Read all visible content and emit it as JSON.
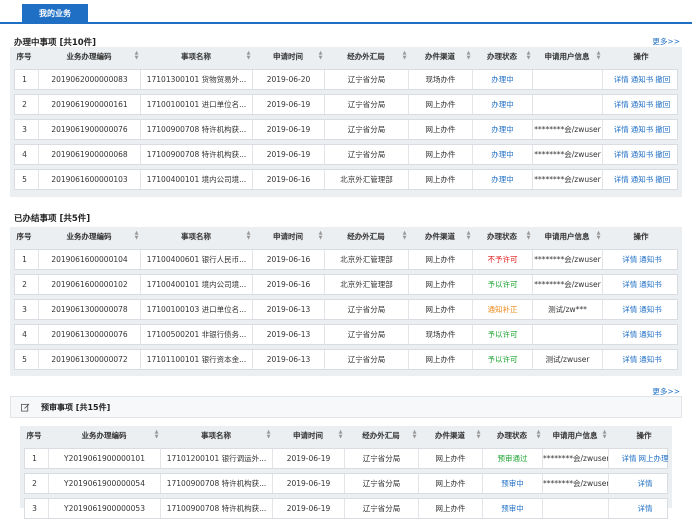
{
  "tab": {
    "label": "我的业务"
  },
  "sections": [
    {
      "title": "办理中事项 [共10件]",
      "more": "更多>>",
      "columns": [
        "序号",
        "业务办理编码",
        "事项名称",
        "申请时间",
        "经办外汇局",
        "办件渠道",
        "办理状态",
        "申请用户信息",
        "操作"
      ],
      "rows": [
        {
          "no": "1",
          "code": "2019062000000083",
          "name": "17101300101 货物贸易外...",
          "date": "2019-06-20",
          "bureau": "辽宁省分局",
          "channel": "现场办件",
          "status": "办理中",
          "status_color": "blue",
          "user": "",
          "ops": [
            "详情",
            "通知书",
            "撤回"
          ]
        },
        {
          "no": "2",
          "code": "2019061900000161",
          "name": "17100100101 进口单位名...",
          "date": "2019-06-19",
          "bureau": "辽宁省分局",
          "channel": "网上办件",
          "status": "办理中",
          "status_color": "blue",
          "user": "",
          "ops": [
            "详情",
            "通知书",
            "撤回"
          ]
        },
        {
          "no": "3",
          "code": "2019061900000076",
          "name": "17100900708 特许机构获...",
          "date": "2019-06-19",
          "bureau": "辽宁省分局",
          "channel": "网上办件",
          "status": "办理中",
          "status_color": "blue",
          "user": "********会/zwuser",
          "ops": [
            "详情",
            "通知书",
            "撤回"
          ]
        },
        {
          "no": "4",
          "code": "2019061900000068",
          "name": "17100900708 特许机构获...",
          "date": "2019-06-19",
          "bureau": "辽宁省分局",
          "channel": "网上办件",
          "status": "办理中",
          "status_color": "blue",
          "user": "********会/zwuser",
          "ops": [
            "详情",
            "通知书",
            "撤回"
          ]
        },
        {
          "no": "5",
          "code": "2019061600000103",
          "name": "17100400101 境内公司境...",
          "date": "2019-06-16",
          "bureau": "北京外汇管理部",
          "channel": "网上办件",
          "status": "办理中",
          "status_color": "blue",
          "user": "********会/zwuser",
          "ops": [
            "详情",
            "通知书",
            "撤回"
          ]
        }
      ]
    },
    {
      "title": "已办结事项 [共5件]",
      "more": "",
      "columns": [
        "序号",
        "业务办理编码",
        "事项名称",
        "申请时间",
        "经办外汇局",
        "办件渠道",
        "办理状态",
        "申请用户信息",
        "操作"
      ],
      "rows": [
        {
          "no": "1",
          "code": "2019061600000104",
          "name": "17100400601 银行人民币...",
          "date": "2019-06-16",
          "bureau": "北京外汇管理部",
          "channel": "网上办件",
          "status": "不予许可",
          "status_color": "red",
          "user": "********会/zwuser",
          "ops": [
            "详情",
            "通知书"
          ]
        },
        {
          "no": "2",
          "code": "2019061600000102",
          "name": "17100400101 境内公司境...",
          "date": "2019-06-16",
          "bureau": "北京外汇管理部",
          "channel": "网上办件",
          "status": "予以许可",
          "status_color": "green",
          "user": "********会/zwuser",
          "ops": [
            "详情",
            "通知书"
          ]
        },
        {
          "no": "3",
          "code": "2019061300000078",
          "name": "17100100103 进口单位名...",
          "date": "2019-06-13",
          "bureau": "辽宁省分局",
          "channel": "网上办件",
          "status": "通知补正",
          "status_color": "orange",
          "user": "测试/zw***",
          "ops": [
            "详情",
            "通知书"
          ]
        },
        {
          "no": "4",
          "code": "2019061300000076",
          "name": "17100500201 非银行债务...",
          "date": "2019-06-13",
          "bureau": "辽宁省分局",
          "channel": "现场办件",
          "status": "予以许可",
          "status_color": "green",
          "user": "",
          "ops": [
            "详情",
            "通知书"
          ]
        },
        {
          "no": "5",
          "code": "2019061300000072",
          "name": "17101100101 银行资本金...",
          "date": "2019-06-13",
          "bureau": "辽宁省分局",
          "channel": "网上办件",
          "status": "予以许可",
          "status_color": "green",
          "user": "测试/zwuser",
          "ops": [
            "详情",
            "通知书"
          ]
        }
      ]
    },
    {
      "title": "预审事项 [共15件]",
      "more": "更多>>",
      "columns": [
        "序号",
        "业务办理编码",
        "事项名称",
        "申请时间",
        "经办外汇局",
        "办件渠道",
        "办理状态",
        "申请用户信息",
        "操作"
      ],
      "rows": [
        {
          "no": "1",
          "code": "Y2019061900000101",
          "name": "17101200101 银行调运外...",
          "date": "2019-06-19",
          "bureau": "辽宁省分局",
          "channel": "网上办件",
          "status": "预审通过",
          "status_color": "green",
          "user": "********会/zwuser",
          "ops": [
            "详情",
            "网上办理"
          ]
        },
        {
          "no": "2",
          "code": "Y2019061900000054",
          "name": "17100900708 特许机构获...",
          "date": "2019-06-19",
          "bureau": "辽宁省分局",
          "channel": "网上办件",
          "status": "预审中",
          "status_color": "blue",
          "user": "********会/zwuser",
          "ops": [
            "详情"
          ]
        },
        {
          "no": "3",
          "code": "Y2019061900000053",
          "name": "17100900708 特许机构获...",
          "date": "2019-06-19",
          "bureau": "辽宁省分局",
          "channel": "网上办件",
          "status": "预审中",
          "status_color": "blue",
          "user": "",
          "ops": [
            "详情"
          ]
        }
      ]
    }
  ],
  "icons": {
    "prereview": "edit-icon"
  },
  "colors": {
    "accent": "#1f6fc5",
    "green": "#1aa32f",
    "red": "#e21b1b",
    "orange": "#ef8a1b"
  }
}
